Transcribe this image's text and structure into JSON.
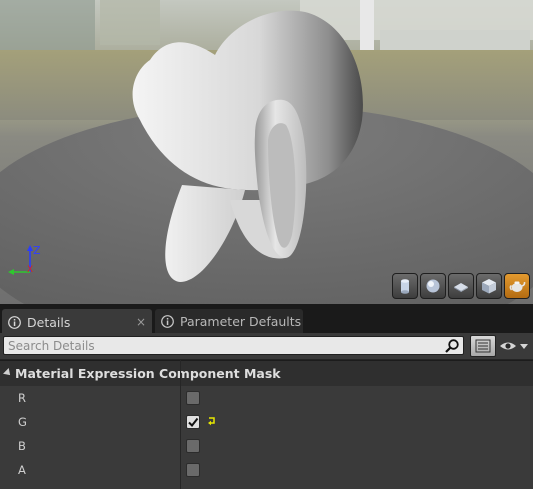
{
  "viewport": {
    "axis_gizmo": {
      "x_label": "X",
      "z_label": "Z"
    },
    "preview_buttons": [
      {
        "name": "cylinder-preview-button",
        "icon": "cylinder-icon",
        "active": false
      },
      {
        "name": "sphere-preview-button",
        "icon": "sphere-icon",
        "active": false
      },
      {
        "name": "plane-preview-button",
        "icon": "plane-icon",
        "active": false
      },
      {
        "name": "cube-preview-button",
        "icon": "cube-icon",
        "active": false
      },
      {
        "name": "custom-mesh-preview-button",
        "icon": "teapot-icon",
        "active": true
      }
    ]
  },
  "tabs": [
    {
      "label": "Details",
      "icon": "info-icon",
      "active": true,
      "close": "×"
    },
    {
      "label": "Parameter Defaults",
      "icon": "info-icon",
      "active": false
    }
  ],
  "search": {
    "placeholder": "Search Details",
    "value": ""
  },
  "category": {
    "title": "Material Expression Component Mask",
    "expanded": true
  },
  "properties": [
    {
      "name": "R",
      "checked": false
    },
    {
      "name": "G",
      "checked": true,
      "reset_to_default": true
    },
    {
      "name": "B",
      "checked": false
    },
    {
      "name": "A",
      "checked": false
    }
  ],
  "colors": {
    "accent_orange": "#d08a24",
    "panel_bg": "#3a3a3a",
    "tab_bar_bg": "#1a1a1a",
    "reset_arrow": "#e8e800"
  }
}
